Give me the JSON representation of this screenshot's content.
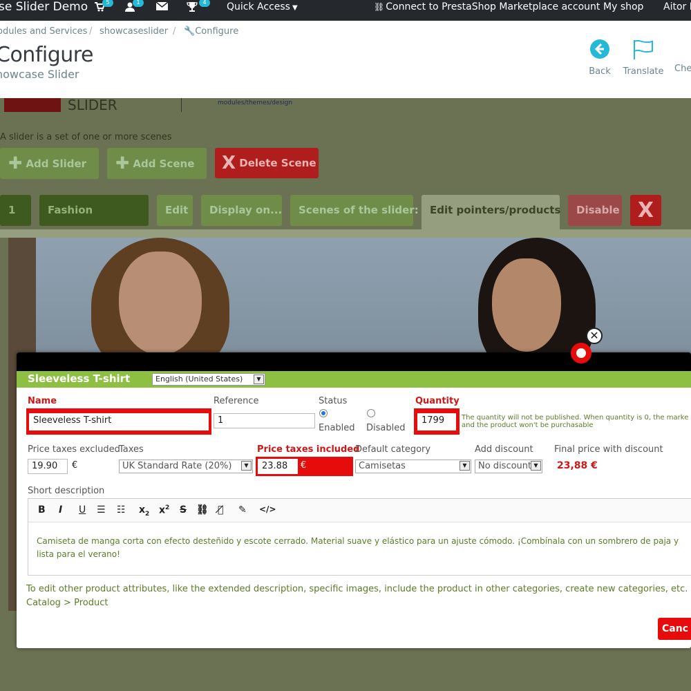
{
  "topbar": {
    "shop_title": "se Slider Demo",
    "cart_badge": "5",
    "users_badge": "1",
    "trophy_badge": "4",
    "quick_access": "Quick Access",
    "connect": "Connect to PrestaShop Marketplace account",
    "my_shop": "My shop",
    "user": "Aitor F"
  },
  "breadcrumb": {
    "items": [
      "odules and Services",
      "showcaseslider",
      "Configure"
    ],
    "separator": "/"
  },
  "header": {
    "title": "Configure",
    "subtitle": "howcase Slider",
    "buttons": [
      "Back",
      "Translate",
      "Che"
    ]
  },
  "module": {
    "logo_text": "SLIDER",
    "path_link": "modules/themes/design",
    "intro": "A slider is a set of one or more scenes"
  },
  "actions": {
    "add_slider": "Add Slider",
    "add_scene": "Add Scene",
    "delete_scene": "Delete Scene"
  },
  "scene_bar": {
    "number": "1",
    "name": "Fashion",
    "edit": "Edit",
    "display_on": "Display on...",
    "scenes_of_slider": "Scenes of the slider:",
    "edit_pointers": "Edit pointers/products",
    "disable": "Disable",
    "remove": "X"
  },
  "product_form": {
    "title": "Sleeveless T-shirt",
    "language": "English (United States)",
    "name_label": "Name",
    "name_value": "Sleeveless T-shirt",
    "reference_label": "Reference",
    "reference_value": "1",
    "status_label": "Status",
    "status_enabled": "Enabled",
    "status_disabled": "Disabled",
    "quantity_label": "Quantity",
    "quantity_value": "1799",
    "quantity_note_1": "The quantity will not be published. When quantity is 0, the marke",
    "quantity_note_2": "and the product won't be purchasable",
    "price_excl_label": "Price taxes excluded",
    "price_excl_value": "19.90",
    "currency": "€",
    "taxes_label": "Taxes",
    "taxes_value": "UK Standard Rate (20%)",
    "price_incl_label": "Price taxes included",
    "price_incl_value": "23.88",
    "category_label": "Default category",
    "category_value": "Camisetas",
    "discount_label": "Add discount",
    "discount_value": "No discount",
    "final_price_label": "Final price with discount",
    "final_price_value": "23,88 €",
    "short_desc_label": "Short description",
    "short_desc_text_1": "Camiseta de manga corta con efecto desteñido y escote cerrado. Material suave y elástico para un ajuste cómodo. ¡Combínala con un sombrero de paja y",
    "short_desc_text_2": "lista para el verano!",
    "footer_1": "To edit other product attributes, like the extended description, specific images, include the product in other categories, create new categories, etc. Go to",
    "footer_2": "Catalog > Product",
    "cancel": "Canc"
  },
  "toolbar_tools": [
    "B",
    "I",
    "U",
    "ordered-list",
    "unordered-list",
    "x2-sub",
    "x2-sup",
    "S",
    "link",
    "unlink",
    "clear-format",
    "</>"
  ],
  "colors": {
    "accent_green": "#8dc042",
    "required_red": "#cc1818",
    "highlight_red": "#e60c0c",
    "topbar": "#25292e",
    "prestashop_blue": "#25b9d7"
  }
}
